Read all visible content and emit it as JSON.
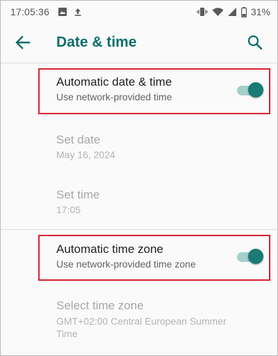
{
  "status_bar": {
    "time": "17:05:36",
    "battery_text": "31%",
    "icons": [
      "image-icon",
      "upload-icon",
      "vibrate-icon",
      "wifi-icon",
      "signal-icon",
      "battery-icon"
    ]
  },
  "app_bar": {
    "title": "Date & time",
    "back_icon": "arrow-back-icon",
    "search_icon": "search-icon"
  },
  "settings": [
    {
      "title": "Automatic date & time",
      "summary": "Use network-provided time",
      "toggle_on": true,
      "enabled": true,
      "highlighted": true
    },
    {
      "title": "Set date",
      "summary": "May 16, 2024",
      "enabled": false
    },
    {
      "title": "Set time",
      "summary": "17:05",
      "enabled": false
    },
    {
      "title": "Automatic time zone",
      "summary": "Use network-provided time zone",
      "toggle_on": true,
      "enabled": true,
      "highlighted": true
    },
    {
      "title": "Select time zone",
      "summary": "GMT+02:00 Central European Summer Time",
      "enabled": false
    }
  ],
  "colors": {
    "accent": "#0c6e6b",
    "toggle_thumb": "#1a7a74",
    "toggle_track": "#a5cfcc",
    "highlight_border": "#d9202f"
  }
}
